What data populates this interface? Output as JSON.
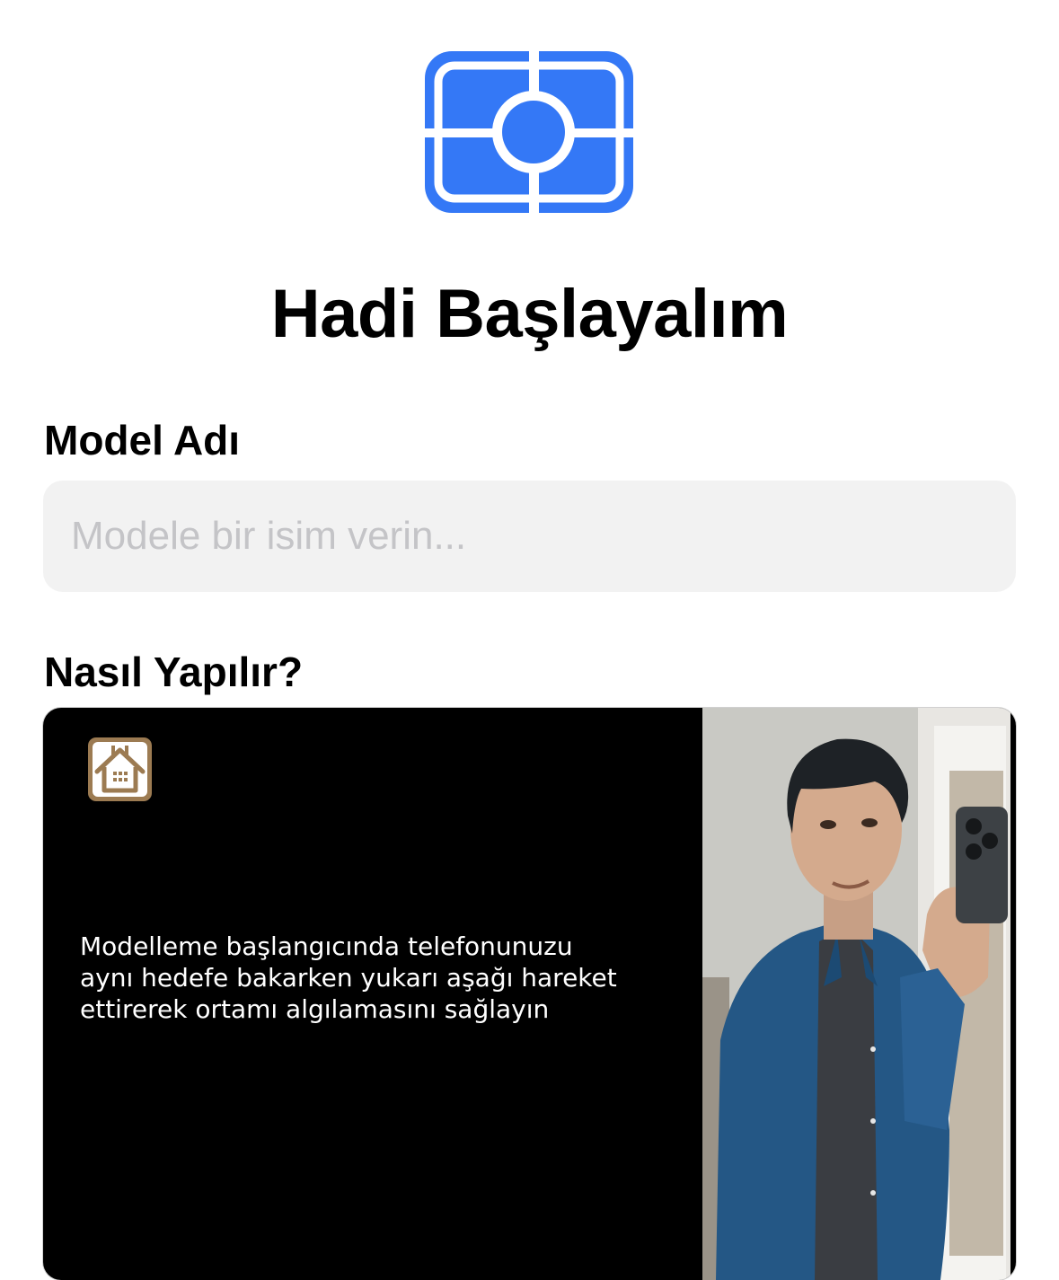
{
  "header": {
    "logo_icon": "viewfinder-scan-icon",
    "title": "Hadi Başlayalım"
  },
  "model_name": {
    "label": "Model Adı",
    "value": "",
    "placeholder": "Modele bir isim verin..."
  },
  "how_to": {
    "label": "Nasıl Yapılır?",
    "home_icon": "house-icon",
    "caption": "Modelleme başlangıcında telefonunuzu\naynı hedefe bakarken yukarı aşağı hareket\nettirerek ortamı algılamasını sağlayın"
  },
  "colors": {
    "accent": "#3478F6",
    "input_background": "#F2F2F2",
    "placeholder": "#C4C4C7",
    "video_background": "#000000",
    "home_icon_brown": "#9C7B52"
  }
}
